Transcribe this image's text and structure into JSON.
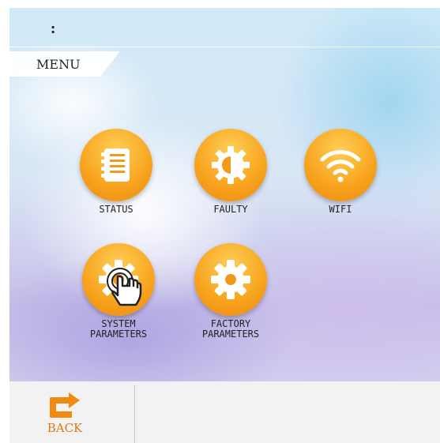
{
  "header": {
    "time": ":",
    "menu_label": "MENU"
  },
  "menu": {
    "items": [
      {
        "label": "STATUS",
        "icon": "notebook-icon"
      },
      {
        "label": "FAULTY",
        "icon": "contrast-gear-icon"
      },
      {
        "label": "WIFI",
        "icon": "wifi-icon"
      },
      {
        "label": "SYSTEM\nPARAMETERS",
        "icon": "gear-icon"
      },
      {
        "label": "FACTORY\nPARAMETERS",
        "icon": "gear-icon"
      }
    ]
  },
  "footer": {
    "back_label": "BACK",
    "back_icon": "return-arrow-icon"
  },
  "colors": {
    "accent": "#f7a21d",
    "back": "#e07b12"
  }
}
